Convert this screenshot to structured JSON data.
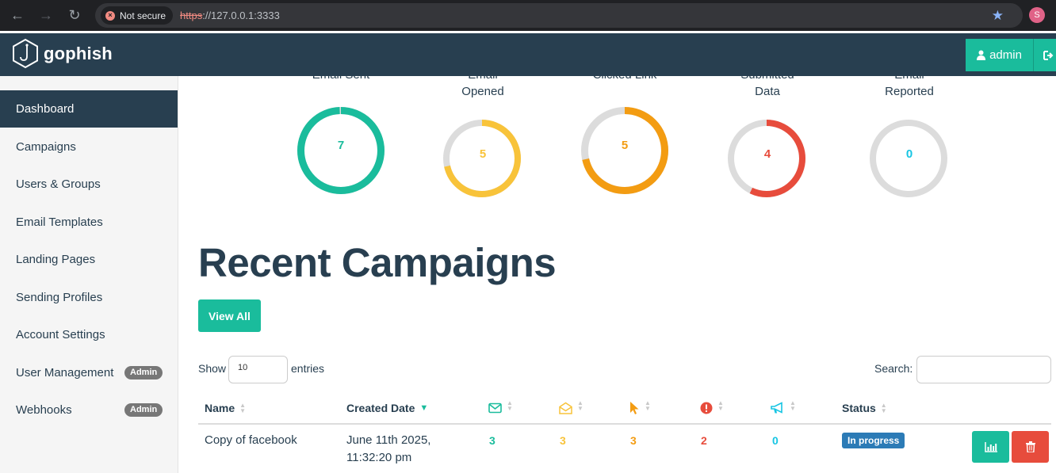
{
  "browser": {
    "security_label": "Not secure",
    "url_protocol": "https",
    "url_rest": "://127.0.0.1:3333",
    "profile_initial": "S"
  },
  "app": {
    "brand": "gophish",
    "user_label": "admin"
  },
  "sidebar": {
    "items": [
      {
        "label": "Dashboard",
        "active": true
      },
      {
        "label": "Campaigns"
      },
      {
        "label": "Users & Groups"
      },
      {
        "label": "Email Templates"
      },
      {
        "label": "Landing Pages"
      },
      {
        "label": "Sending Profiles"
      },
      {
        "label": "Account Settings"
      },
      {
        "label": "User Management",
        "badge": "Admin"
      },
      {
        "label": "Webhooks",
        "badge": "Admin"
      }
    ]
  },
  "stats": [
    {
      "label_top": "Email Sent",
      "label_bottom": "",
      "value": "7",
      "fraction": 1.0,
      "color": "#1abc9c"
    },
    {
      "label_top": "Email",
      "label_bottom": "Opened",
      "value": "5",
      "fraction": 0.714,
      "color": "#f8c33a"
    },
    {
      "label_top": "Clicked Link",
      "label_bottom": "",
      "value": "5",
      "fraction": 0.714,
      "color": "#f39c12"
    },
    {
      "label_top": "Submitted",
      "label_bottom": "Data",
      "value": "4",
      "fraction": 0.571,
      "color": "#e74c3c"
    },
    {
      "label_top": "Email",
      "label_bottom": "Reported",
      "value": "0",
      "fraction": 0.0,
      "color": "#17c5e3"
    }
  ],
  "main": {
    "heading": "Recent Campaigns",
    "view_all": "View All",
    "show_label": "Show",
    "entries_value": "10",
    "entries_label": "entries",
    "search_label": "Search:"
  },
  "table": {
    "headers": {
      "name": "Name",
      "created": "Created Date",
      "status": "Status"
    },
    "header_icons": [
      "envelope-icon",
      "envelope-open-icon",
      "pointer-icon",
      "exclamation-circle-icon",
      "bullhorn-icon"
    ],
    "rows": [
      {
        "name": "Copy of facebook",
        "created_line1": "June 11th 2025,",
        "created_line2": "11:32:20 pm",
        "sent": "3",
        "opened": "3",
        "clicked": "3",
        "submitted": "2",
        "reported": "0",
        "status": "In progress"
      }
    ]
  },
  "colors": {
    "accent": "#1abc9c",
    "navy": "#283f50",
    "sent": "#1abc9c",
    "opened": "#f8c33a",
    "clicked": "#f39c12",
    "submitted": "#e74c3c",
    "reported": "#17c5e3",
    "status_blue": "#2c7bb6"
  }
}
